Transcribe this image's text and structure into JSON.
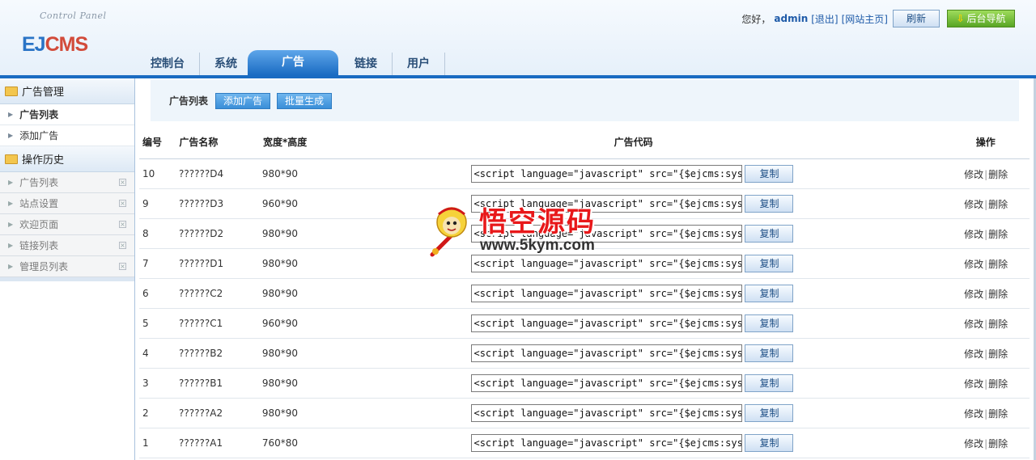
{
  "header": {
    "cp_text": "Control Panel",
    "logo_blue": "EJ",
    "logo_red": "CMS",
    "greeting": "您好，",
    "username": "admin",
    "logout": "[退出]",
    "site_home": "[网站主页]",
    "refresh": "刷新",
    "admin_nav": "后台导航",
    "tabs": [
      "控制台",
      "系统",
      "广告",
      "链接",
      "用户"
    ],
    "active_tab": "广告"
  },
  "sidebar": {
    "section1": "广告管理",
    "items": [
      "广告列表",
      "添加广告"
    ],
    "section2": "操作历史",
    "history": [
      "广告列表",
      "站点设置",
      "欢迎页面",
      "链接列表",
      "管理员列表"
    ]
  },
  "toolbar": {
    "title": "广告列表",
    "add_button": "添加广告",
    "batch_button": "批量生成"
  },
  "table": {
    "headers": {
      "id": "编号",
      "name": "广告名称",
      "size": "宽度*高度",
      "code": "广告代码",
      "ops": "操作"
    },
    "copy_label": "复制",
    "edit_label": "修改",
    "delete_label": "删除",
    "rows": [
      {
        "id": "10",
        "name": "??????D4",
        "size": "980*90",
        "code": "<script language=\"javascript\" src=\"{$ejcms:syst"
      },
      {
        "id": "9",
        "name": "??????D3",
        "size": "960*90",
        "code": "<script language=\"javascript\" src=\"{$ejcms:syst"
      },
      {
        "id": "8",
        "name": "??????D2",
        "size": "980*90",
        "code": "<script language=\"javascript\" src=\"{$ejcms:syst"
      },
      {
        "id": "7",
        "name": "??????D1",
        "size": "980*90",
        "code": "<script language=\"javascript\" src=\"{$ejcms:syst"
      },
      {
        "id": "6",
        "name": "??????C2",
        "size": "980*90",
        "code": "<script language=\"javascript\" src=\"{$ejcms:syst"
      },
      {
        "id": "5",
        "name": "??????C1",
        "size": "960*90",
        "code": "<script language=\"javascript\" src=\"{$ejcms:syst"
      },
      {
        "id": "4",
        "name": "??????B2",
        "size": "980*90",
        "code": "<script language=\"javascript\" src=\"{$ejcms:syst"
      },
      {
        "id": "3",
        "name": "??????B1",
        "size": "980*90",
        "code": "<script language=\"javascript\" src=\"{$ejcms:syst"
      },
      {
        "id": "2",
        "name": "??????A2",
        "size": "980*90",
        "code": "<script language=\"javascript\" src=\"{$ejcms:syst"
      },
      {
        "id": "1",
        "name": "??????A1",
        "size": "760*80",
        "code": "<script language=\"javascript\" src=\"{$ejcms:syst"
      }
    ]
  },
  "watermark": {
    "title": "悟空源码",
    "url": "www.5kym.com"
  }
}
